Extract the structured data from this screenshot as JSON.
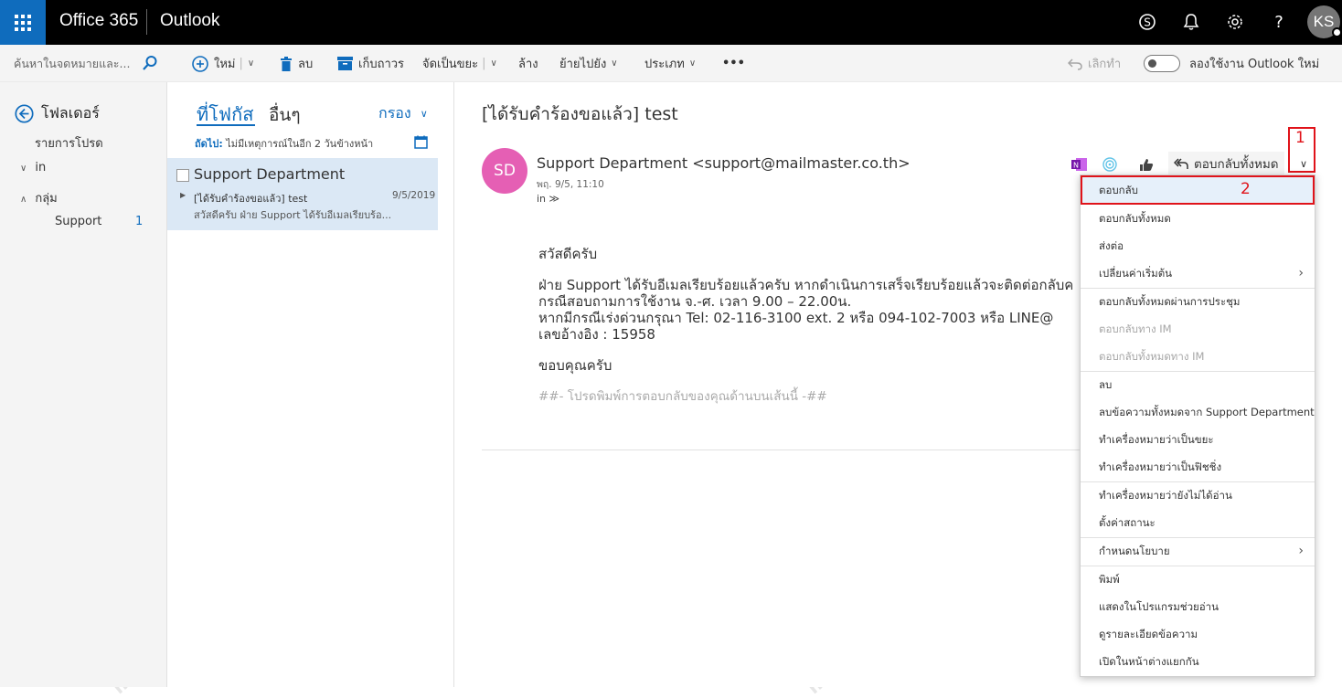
{
  "topbar": {
    "brand": "Office 365",
    "app": "Outlook",
    "user_initials": "KS",
    "icons": [
      "skype-icon",
      "bell-icon",
      "gear-icon",
      "help-icon"
    ]
  },
  "search": {
    "placeholder": "ค้นหาในจดหมายและ..."
  },
  "commands": {
    "new": "ใหม่",
    "delete": "ลบ",
    "archive": "เก็บถาวร",
    "junk": "จัดเป็นขยะ",
    "sweep": "ล้าง",
    "move": "ย้ายไปยัง",
    "categorize": "ประเภท",
    "more": "•••",
    "undo": "เลิกทำ",
    "try_new": "ลองใช้งาน Outlook ใหม่"
  },
  "nav": {
    "folders": "โฟลเดอร์",
    "favorites": "รายการโปรด",
    "in": "in",
    "groups": "กลุ่ม",
    "support": "Support",
    "support_count": "1"
  },
  "list": {
    "tab_focused": "ที่โฟกัส",
    "tab_other": "อื่นๆ",
    "filter": "กรอง",
    "next_label": "ถัดไป:",
    "next_text": "ไม่มีเหตุการณ์ในอีก 2 วันข้างหน้า",
    "message": {
      "sender": "Support Department",
      "subject": "[ได้รับคำร้องขอแล้ว] test",
      "date": "9/5/2019",
      "preview": "สวัสดีครับ  ฝ่าย Support ได้รับอีเมลเรียบร้อ..."
    }
  },
  "reading": {
    "subject": "[ได้รับคำร้องขอแล้ว] test",
    "avatar_initials": "SD",
    "sender": "Support Department <support@mailmaster.co.th>",
    "date": "พฤ. 9/5, 11:10",
    "to": "in ≫",
    "reply_all": "ตอบกลับทั้งหมด",
    "body": {
      "greeting": "สวัสดีครับ",
      "line1": "ฝ่าย Support ได้รับอีเมลเรียบร้อยแล้วครับ หากดำเนินการเสร็จเรียบร้อยแล้วจะติดต่อกลับค",
      "line2": "กรณีสอบถามการใช้งาน จ.-ศ. เวลา 9.00 – 22.00น.",
      "line3": "หากมีกรณีเร่งด่วนกรุณา Tel: 02-116-3100 ext. 2 หรือ 094-102-7003 หรือ LINE@",
      "line4": "เลขอ้างอิง : 15958",
      "thanks": "ขอบคุณครับ",
      "signature": "##- โปรดพิมพ์การตอบกลับของคุณด้านบนเส้นนี้ -##"
    }
  },
  "menu": {
    "items": [
      "ตอบกลับ",
      "ตอบกลับทั้งหมด",
      "ส่งต่อ",
      "เปลี่ยนค่าเริ่มต้น",
      "ตอบกลับทั้งหมดผ่านการประชุม",
      "ตอบกลับทาง IM",
      "ตอบกลับทั้งหมดทาง IM",
      "ลบ",
      "ลบข้อความทั้งหมดจาก Support Department",
      "ทำเครื่องหมายว่าเป็นขยะ",
      "ทำเครื่องหมายว่าเป็นฟิชชิ่ง",
      "ทำเครื่องหมายว่ายังไม่ได้อ่าน",
      "ตั้งค่าสถานะ",
      "กำหนดนโยบาย",
      "พิมพ์",
      "แสดงในโปรแกรมช่วยอ่าน",
      "ดูรายละเอียดข้อความ",
      "เปิดในหน้าต่างแยกกัน"
    ]
  },
  "annotations": {
    "step1": "1",
    "step2": "2"
  },
  "watermark": "mail master",
  "colors": {
    "accent": "#0f6cbd",
    "avatar": "#e55fb4",
    "highlight": "#e0131a",
    "selected_row": "#dbe8f5"
  }
}
